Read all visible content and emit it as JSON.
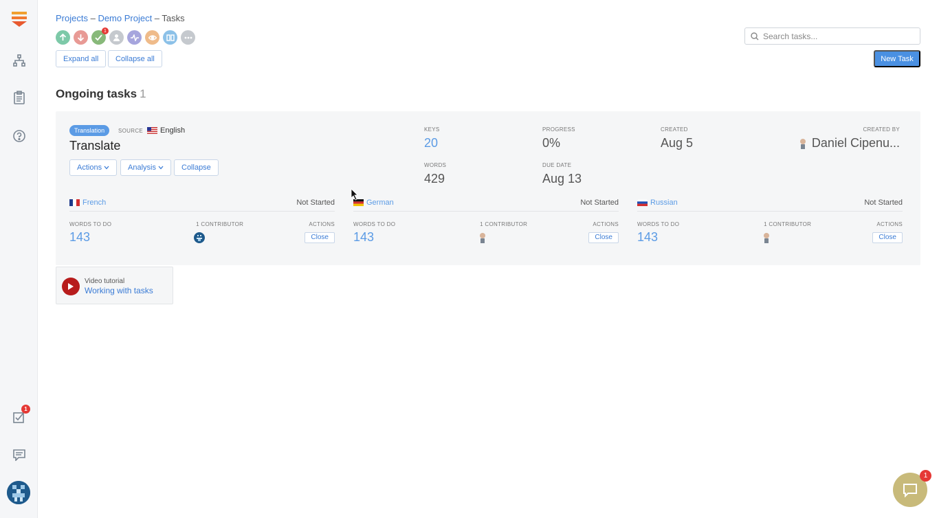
{
  "breadcrumb": {
    "projects": "Projects",
    "sep1": " – ",
    "project": "Demo Project",
    "sep2": " – ",
    "current": "Tasks"
  },
  "filters": {
    "icons": [
      "upload-icon",
      "download-icon",
      "check-icon",
      "user-icon",
      "activity-icon",
      "eye-icon",
      "book-icon",
      "more-icon"
    ],
    "check_badge": "1"
  },
  "toolbar": {
    "expand_all": "Expand all",
    "collapse_all": "Collapse all",
    "new_task": "New Task"
  },
  "search": {
    "placeholder": "Search tasks..."
  },
  "section": {
    "title": "Ongoing tasks",
    "count": "1"
  },
  "task": {
    "tag": "Translation",
    "source_label": "SOURCE",
    "source_lang": "English",
    "title": "Translate",
    "buttons": {
      "actions": "Actions",
      "analysis": "Analysis",
      "collapse": "Collapse"
    },
    "keys_label": "KEYS",
    "keys": "20",
    "words_label": "WORDS",
    "words": "429",
    "progress_label": "PROGRESS",
    "progress": "0%",
    "due_label": "DUE DATE",
    "due": "Aug 13",
    "created_label": "CREATED",
    "created": "Aug 5",
    "created_by_label": "CREATED BY",
    "created_by": "Daniel Cipenu...",
    "languages": [
      {
        "name": "French",
        "status": "Not Started",
        "words_label": "WORDS TO DO",
        "contrib_label": "1 CONTRIBUTOR",
        "actions_label": "ACTIONS",
        "words": "143",
        "close": "Close"
      },
      {
        "name": "German",
        "status": "Not Started",
        "words_label": "WORDS TO DO",
        "contrib_label": "1 CONTRIBUTOR",
        "actions_label": "ACTIONS",
        "words": "143",
        "close": "Close"
      },
      {
        "name": "Russian",
        "status": "Not Started",
        "words_label": "WORDS TO DO",
        "contrib_label": "1 CONTRIBUTOR",
        "actions_label": "ACTIONS",
        "words": "143",
        "close": "Close"
      }
    ]
  },
  "video": {
    "label": "Video tutorial",
    "link": "Working with tasks"
  },
  "sidebar": {
    "tasks_badge": "1"
  },
  "chat": {
    "badge": "1"
  }
}
